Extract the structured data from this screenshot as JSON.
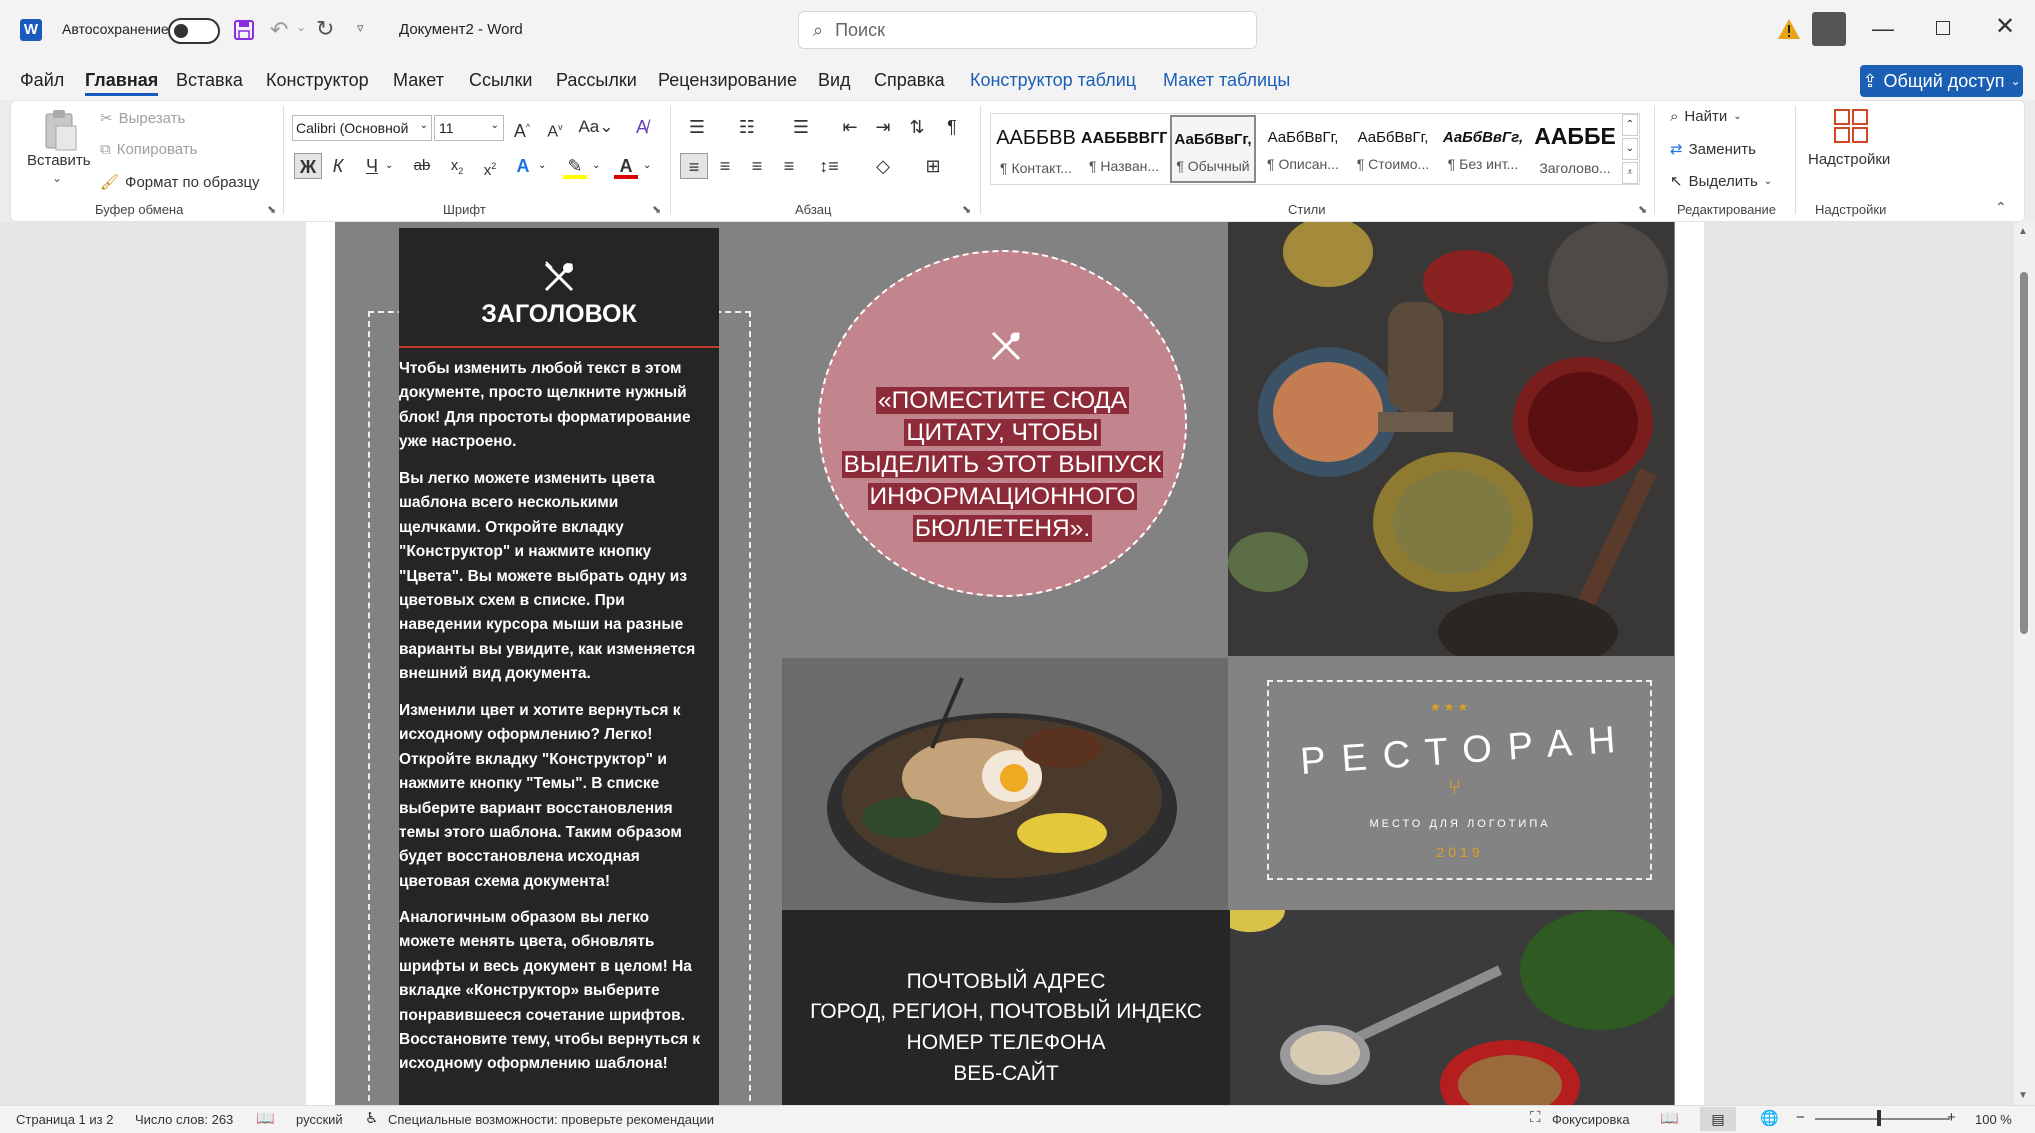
{
  "titlebar": {
    "autosave_label": "Автосохранение",
    "doc_title": "Документ2 - Word",
    "search_placeholder": "Поиск"
  },
  "menu": {
    "items": [
      "Файл",
      "Главная",
      "Вставка",
      "Конструктор",
      "Макет",
      "Ссылки",
      "Рассылки",
      "Рецензирование",
      "Вид",
      "Справка"
    ],
    "contextual": [
      "Конструктор таблиц",
      "Макет таблицы"
    ],
    "share_label": "Общий доступ"
  },
  "ribbon": {
    "clipboard": {
      "paste": "Вставить",
      "cut": "Вырезать",
      "copy": "Копировать",
      "format_painter": "Формат по образцу",
      "group_label": "Буфер обмена"
    },
    "font": {
      "font_name": "Calibri (Основной",
      "font_size": "11",
      "group_label": "Шрифт"
    },
    "paragraph": {
      "group_label": "Абзац"
    },
    "styles": {
      "group_label": "Стили",
      "items": [
        {
          "preview": "ААББВВ",
          "name": "¶ Контакт..."
        },
        {
          "preview": "ААББВВГГ",
          "name": "¶ Назван..."
        },
        {
          "preview": "АаБбВвГг,",
          "name": "¶ Обычный"
        },
        {
          "preview": "АаБбВвГг,",
          "name": "¶ Описан..."
        },
        {
          "preview": "АаБбВвГг,",
          "name": "¶ Стоимо..."
        },
        {
          "preview": "АаБбВвГг,",
          "name": "¶ Без инт..."
        },
        {
          "preview": "ААББЕ",
          "name": "Заголово..."
        }
      ]
    },
    "editing": {
      "find": "Найти",
      "replace": "Заменить",
      "select": "Выделить",
      "group_label": "Редактирование"
    },
    "addins": {
      "button": "Надстройки",
      "group_label": "Надстройки"
    }
  },
  "document": {
    "heading": "ЗАГОЛОВОК",
    "paragraphs": [
      [
        "Чтобы изменить любой текст в этом",
        "документе, просто щелкните нужный",
        "блок! Для простоты форматирование",
        "уже настроено."
      ],
      [
        "Вы легко можете изменить цвета",
        "шаблона всего несколькими",
        "щелчками. Откройте вкладку",
        "\"Конструктор\" и нажмите кнопку",
        "\"Цвета\". Вы можете выбрать одну из",
        "цветовых схем в списке. При",
        "наведении курсора мыши на разные",
        "варианты вы увидите, как изменяется",
        "внешний вид документа."
      ],
      [
        "Изменили цвет и хотите вернуться к",
        "исходному оформлению? Легко!",
        "Откройте вкладку \"Конструктор\" и",
        "нажмите кнопку \"Темы\". В списке",
        "выберите вариант восстановления",
        "темы этого шаблона. Таким образом",
        "будет восстановлена исходная",
        "цветовая схема документа!"
      ],
      [
        "Аналогичным образом вы легко",
        "можете менять цвета, обновлять",
        "шрифты и весь документ в целом! На",
        "вкладке «Конструктор» выберите",
        "понравившееся сочетание шрифтов.",
        "Восстановите тему, чтобы вернуться к",
        "исходному оформлению шаблона!"
      ]
    ],
    "quote_lines": [
      "«ПОМЕСТИТЕ СЮДА",
      "ЦИТАТУ, ЧТОБЫ",
      "ВЫДЕЛИТЬ ЭТОТ ВЫПУСК",
      "ИНФОРМАЦИОННОГО",
      "БЮЛЛЕТЕНЯ»."
    ],
    "logo": {
      "title": "РЕСТОРАН",
      "subtitle": "МЕСТО ДЛЯ ЛОГОТИПА",
      "year": "2019"
    },
    "contact_lines": [
      "ПОЧТОВЫЙ АДРЕС",
      "ГОРОД, РЕГИОН, ПОЧТОВЫЙ ИНДЕКС",
      "НОМЕР ТЕЛЕФОНА",
      "ВЕБ-САЙТ"
    ]
  },
  "statusbar": {
    "page": "Страница 1 из 2",
    "words": "Число слов: 263",
    "language": "русский",
    "accessibility": "Специальные возможности: проверьте рекомендации",
    "focus": "Фокусировка",
    "zoom": "100 %"
  },
  "colors": {
    "accent_blue": "#1a5fb4",
    "quote_bg": "#8e2b39",
    "circle_bg": "#c2848d",
    "panel_dark": "#252525",
    "logo_gold": "#e0a020"
  }
}
